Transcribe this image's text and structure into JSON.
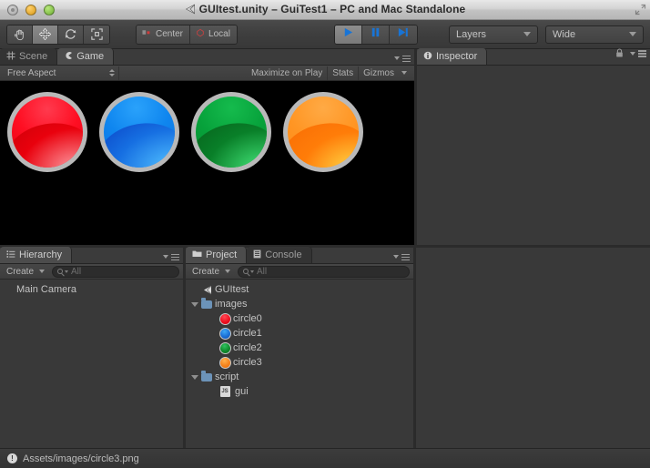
{
  "window": {
    "title": "GUItest.unity – GuiTest1 – PC and Mac Standalone",
    "buttons": {
      "close": "close-button",
      "minimize": "minimize-button",
      "maximize": "maximize-button"
    }
  },
  "toolbar": {
    "tools": [
      {
        "name": "hand-tool",
        "icon": "hand-icon",
        "active": false
      },
      {
        "name": "move-tool",
        "icon": "move-icon",
        "active": true
      },
      {
        "name": "rotate-tool",
        "icon": "rotate-icon",
        "active": false
      },
      {
        "name": "scale-tool",
        "icon": "scale-icon",
        "active": false
      }
    ],
    "pivot_label": "Center",
    "rotation_label": "Local",
    "play_label": "play-icon",
    "pause_label": "pause-icon",
    "step_label": "step-icon",
    "layers_label": "Layers",
    "layout_label": "Wide"
  },
  "scene_game_panel": {
    "tabs": [
      {
        "label": "Scene",
        "icon": "grid-icon",
        "active": false
      },
      {
        "label": "Game",
        "icon": "gamepad-icon",
        "active": true
      }
    ],
    "aspect_label": "Free Aspect",
    "maximize_on_play": "Maximize on Play",
    "stats": "Stats",
    "gizmos": "Gizmos",
    "background": "#000000",
    "circles": [
      {
        "name": "circle0",
        "base": "#ff0b1e",
        "top": "#f81d3c",
        "bottom": "#e40000",
        "highlight": "#ff6b74",
        "ring": "#b7b7b7"
      },
      {
        "name": "circle1",
        "base": "#1484ec",
        "top": "#2f9ef7",
        "bottom": "#0a52d2",
        "highlight": "#5cc6ff",
        "ring": "#b7b7b7"
      },
      {
        "name": "circle2",
        "base": "#08a33c",
        "top": "#10b348",
        "bottom": "#0b7d21",
        "highlight": "#3fe070",
        "ring": "#b7b7b7"
      },
      {
        "name": "circle3",
        "base": "#ff9622",
        "top": "#ffa23a",
        "bottom": "#ff7a0a",
        "highlight": "#ffd24a",
        "ring": "#b7b7b7"
      }
    ]
  },
  "inspector": {
    "tab_label": "Inspector",
    "tab_icon": "info-icon",
    "lock_icon": "lock-icon"
  },
  "hierarchy": {
    "tab_label": "Hierarchy",
    "tab_icon": "list-icon",
    "create_label": "Create",
    "search_placeholder": "All",
    "items": [
      {
        "label": "Main Camera"
      }
    ]
  },
  "project": {
    "tabs": [
      {
        "label": "Project",
        "icon": "folder-icon",
        "active": true
      },
      {
        "label": "Console",
        "icon": "console-icon",
        "active": false
      }
    ],
    "create_label": "Create",
    "search_placeholder": "All",
    "tree": [
      {
        "label": "GUItest",
        "indent": 0,
        "twisty": false,
        "icon": "unity-scene-icon"
      },
      {
        "label": "images",
        "indent": 0,
        "twisty": true,
        "icon": "folder-icon"
      },
      {
        "label": "circle0",
        "indent": 1,
        "twisty": false,
        "icon": "circle-thumb",
        "color": "#ef1c2c"
      },
      {
        "label": "circle1",
        "indent": 1,
        "twisty": false,
        "icon": "circle-thumb",
        "color": "#1b6fd6"
      },
      {
        "label": "circle2",
        "indent": 1,
        "twisty": false,
        "icon": "circle-thumb",
        "color": "#12862c"
      },
      {
        "label": "circle3",
        "indent": 1,
        "twisty": false,
        "icon": "circle-thumb",
        "color": "#f08722"
      },
      {
        "label": "script",
        "indent": 0,
        "twisty": true,
        "icon": "folder-icon"
      },
      {
        "label": "gui",
        "indent": 1,
        "twisty": false,
        "icon": "js-script-icon",
        "badge": "JS"
      }
    ]
  },
  "statusbar": {
    "icon": "info-icon",
    "text": "Assets/images/circle3.png"
  }
}
